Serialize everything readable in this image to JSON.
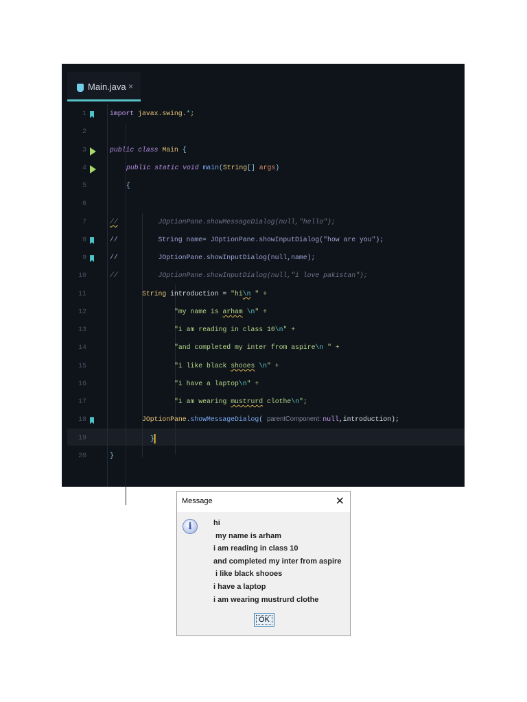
{
  "editor": {
    "tab": {
      "name": "Main.java",
      "close": "×",
      "icon": "java-file-icon"
    },
    "lines": [
      {
        "n": "1",
        "gutter": "bookmark",
        "indent": 0,
        "tokens": [
          [
            "import ",
            "kw"
          ],
          [
            "javax.swing.",
            "pk"
          ],
          [
            "*",
            "esc"
          ],
          [
            ";",
            "pk"
          ]
        ]
      },
      {
        "n": "2",
        "gutter": "",
        "indent": 0,
        "tokens": []
      },
      {
        "n": "3",
        "gutter": "run",
        "indent": 0,
        "tokens": [
          [
            "public class ",
            "k"
          ],
          [
            "Main ",
            "cls"
          ],
          [
            "{",
            "pu"
          ]
        ]
      },
      {
        "n": "4",
        "gutter": "run",
        "indent": 4,
        "tokens": [
          [
            "public static void ",
            "k"
          ],
          [
            "main",
            "fn"
          ],
          [
            "(",
            "pu"
          ],
          [
            "String",
            "cls"
          ],
          [
            "[] ",
            "pu"
          ],
          [
            "args",
            "pa"
          ],
          [
            ")",
            "pu"
          ]
        ]
      },
      {
        "n": "5",
        "gutter": "",
        "indent": 4,
        "tokens": [
          [
            "{",
            "pu"
          ]
        ]
      },
      {
        "n": "6",
        "gutter": "",
        "indent": 0,
        "tokens": []
      },
      {
        "n": "7",
        "gutter": "",
        "indent": 0,
        "tokens": [
          [
            "//",
            "cm sq"
          ],
          [
            "          JOptionPane.showMessageDialog(null,\"hello\");",
            "cm"
          ]
        ]
      },
      {
        "n": "8",
        "gutter": "bookmark",
        "indent": 0,
        "tokens": [
          [
            "//",
            "cmn"
          ],
          [
            "          String name= JOptionPane.showInputDialog(\"how are you\");",
            "cmn"
          ]
        ]
      },
      {
        "n": "9",
        "gutter": "bookmark",
        "indent": 0,
        "tokens": [
          [
            "//",
            "cmn"
          ],
          [
            "          JOptionPane.showInputDialog(null,name);",
            "cmn"
          ]
        ]
      },
      {
        "n": "10",
        "gutter": "",
        "indent": 0,
        "tokens": [
          [
            "//",
            "cm"
          ],
          [
            "          JOptionPane.showInputDialog(null,\"i love pakistan\");",
            "cm"
          ]
        ]
      },
      {
        "n": "11",
        "gutter": "",
        "indent": 8,
        "tokens": [
          [
            "String ",
            "cls"
          ],
          [
            "introduction = ",
            "id"
          ],
          [
            "\"hi",
            "st"
          ],
          [
            "\\n",
            "esc sq"
          ],
          [
            " \" +",
            "st"
          ]
        ]
      },
      {
        "n": "12",
        "gutter": "",
        "indent": 16,
        "tokens": [
          [
            "\"my name is ",
            "st"
          ],
          [
            "arham",
            "st sq"
          ],
          [
            " ",
            "st"
          ],
          [
            "\\n",
            "esc"
          ],
          [
            "\" +",
            "st"
          ]
        ]
      },
      {
        "n": "13",
        "gutter": "",
        "indent": 16,
        "tokens": [
          [
            "\"i am reading in class 10",
            "st"
          ],
          [
            "\\n",
            "esc"
          ],
          [
            "\" +",
            "st"
          ]
        ]
      },
      {
        "n": "14",
        "gutter": "",
        "indent": 16,
        "tokens": [
          [
            "\"and completed my inter from aspire",
            "st"
          ],
          [
            "\\n",
            "esc"
          ],
          [
            " \" +",
            "st"
          ]
        ]
      },
      {
        "n": "15",
        "gutter": "",
        "indent": 16,
        "tokens": [
          [
            "\"i like black ",
            "st"
          ],
          [
            "shooes",
            "st sq"
          ],
          [
            " ",
            "st"
          ],
          [
            "\\n",
            "esc"
          ],
          [
            "\" +",
            "st"
          ]
        ]
      },
      {
        "n": "16",
        "gutter": "",
        "indent": 16,
        "tokens": [
          [
            "\"i have a laptop",
            "st"
          ],
          [
            "\\n",
            "esc"
          ],
          [
            "\" +",
            "st"
          ]
        ]
      },
      {
        "n": "17",
        "gutter": "",
        "indent": 16,
        "tokens": [
          [
            "\"i am wearing ",
            "st"
          ],
          [
            "mustrurd",
            "st sq"
          ],
          [
            " clothe",
            "st"
          ],
          [
            "\\n",
            "esc"
          ],
          [
            "\";",
            "st"
          ]
        ]
      },
      {
        "n": "18",
        "gutter": "bookmark",
        "indent": 8,
        "tokens": [
          [
            "JOptionPane",
            "cls"
          ],
          [
            ".",
            "pu"
          ],
          [
            "showMessageDialog",
            "fn"
          ],
          [
            "( ",
            "pu"
          ],
          [
            "parentComponent: ",
            "hint"
          ],
          [
            "null",
            "nl"
          ],
          [
            ",introduction);",
            "id"
          ]
        ]
      },
      {
        "n": "19",
        "gutter": "",
        "indent": 10,
        "tokens": [
          [
            "}",
            "pu"
          ]
        ],
        "caret": true
      },
      {
        "n": "20",
        "gutter": "",
        "indent": 0,
        "tokens": [
          [
            "}",
            "pu"
          ]
        ]
      }
    ]
  },
  "dialog": {
    "title": "Message",
    "close": "✕",
    "icon": "i",
    "message_lines": [
      "hi",
      " my name is arham",
      "i am reading in class 10",
      "and completed my inter from aspire",
      " i like black shooes",
      "i have a laptop",
      "i am wearing mustrurd clothe"
    ],
    "ok_label": "OK"
  }
}
